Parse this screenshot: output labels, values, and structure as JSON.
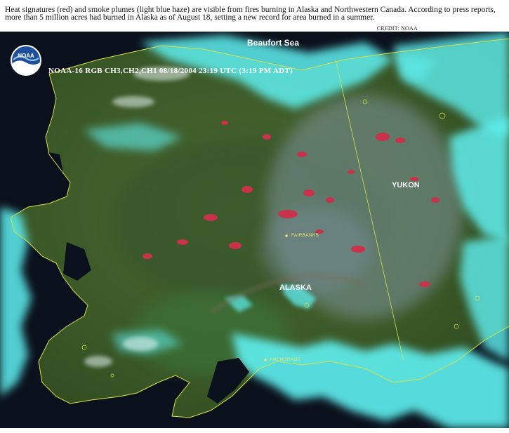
{
  "caption": "Heat signatures (red) and smoke plumes (light blue haze) are visible from fires burning in Alaska and Northwestern Canada. According to press reports, more than 5 million acres had burned in Alaska as of August 18, setting a new record for area burned in a summer.",
  "credit": "CREDIT: NOAA",
  "logo_text": "NOAA",
  "sensor_line": "NOAA-16  RGB  CH3,CH2,CH1  08/18/2004  23:19 UTC (3:19 PM ADT)",
  "labels": {
    "beaufort_sea": "Beaufort Sea",
    "yukon": "YUKON",
    "alaska": "ALASKA",
    "fairbanks": "FAIRBANKS",
    "anchorage": "ANCHORAGE"
  },
  "colors": {
    "land": "#3d5a2a",
    "cloud": "#5ff0f0",
    "fire": "#c8324a",
    "ocean": "#0b111c",
    "coastline": "#d6e04a"
  }
}
